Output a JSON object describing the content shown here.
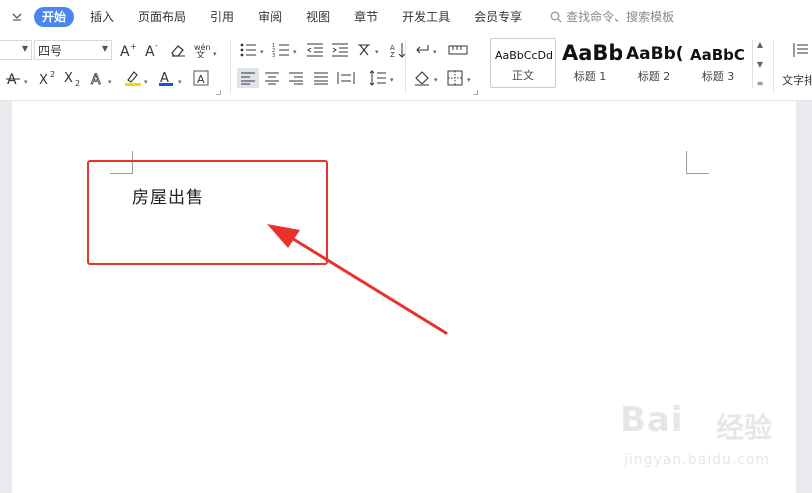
{
  "menubar": {
    "tabs": [
      {
        "label": "开始",
        "active": true
      },
      {
        "label": "插入"
      },
      {
        "label": "页面布局"
      },
      {
        "label": "引用"
      },
      {
        "label": "审阅"
      },
      {
        "label": "视图"
      },
      {
        "label": "章节"
      },
      {
        "label": "开发工具"
      },
      {
        "label": "会员专享"
      }
    ],
    "search_label": "查找命令、搜索模板"
  },
  "toolbar": {
    "font_size": "四号",
    "style_gallery": [
      {
        "preview": "AaBbCcDd",
        "name": "正文",
        "selected": true
      },
      {
        "preview": "AaBb",
        "name": "标题 1"
      },
      {
        "preview": "AaBb(",
        "name": "标题 2"
      },
      {
        "preview": "AaBbC",
        "name": "标题 3"
      }
    ],
    "text_tool_label": "文字排"
  },
  "document": {
    "text": "房屋出售"
  },
  "watermark": {
    "logo": "Bai",
    "brand": "经验",
    "url": "jingyan.baidu.com"
  },
  "colors": {
    "accent": "#4a85f0",
    "annotation": "#e8322b",
    "highlight": "#f5d800",
    "font_color": "#1a4fd6"
  }
}
